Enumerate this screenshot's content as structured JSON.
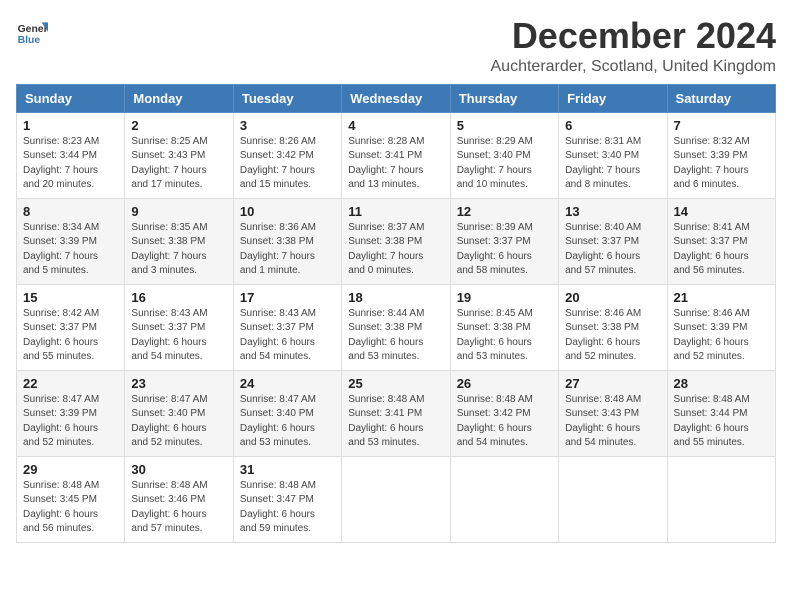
{
  "logo": {
    "line1": "General",
    "line2": "Blue"
  },
  "title": "December 2024",
  "subtitle": "Auchterarder, Scotland, United Kingdom",
  "days_of_week": [
    "Sunday",
    "Monday",
    "Tuesday",
    "Wednesday",
    "Thursday",
    "Friday",
    "Saturday"
  ],
  "weeks": [
    [
      {
        "day": "1",
        "info": "Sunrise: 8:23 AM\nSunset: 3:44 PM\nDaylight: 7 hours\nand 20 minutes."
      },
      {
        "day": "2",
        "info": "Sunrise: 8:25 AM\nSunset: 3:43 PM\nDaylight: 7 hours\nand 17 minutes."
      },
      {
        "day": "3",
        "info": "Sunrise: 8:26 AM\nSunset: 3:42 PM\nDaylight: 7 hours\nand 15 minutes."
      },
      {
        "day": "4",
        "info": "Sunrise: 8:28 AM\nSunset: 3:41 PM\nDaylight: 7 hours\nand 13 minutes."
      },
      {
        "day": "5",
        "info": "Sunrise: 8:29 AM\nSunset: 3:40 PM\nDaylight: 7 hours\nand 10 minutes."
      },
      {
        "day": "6",
        "info": "Sunrise: 8:31 AM\nSunset: 3:40 PM\nDaylight: 7 hours\nand 8 minutes."
      },
      {
        "day": "7",
        "info": "Sunrise: 8:32 AM\nSunset: 3:39 PM\nDaylight: 7 hours\nand 6 minutes."
      }
    ],
    [
      {
        "day": "8",
        "info": "Sunrise: 8:34 AM\nSunset: 3:39 PM\nDaylight: 7 hours\nand 5 minutes."
      },
      {
        "day": "9",
        "info": "Sunrise: 8:35 AM\nSunset: 3:38 PM\nDaylight: 7 hours\nand 3 minutes."
      },
      {
        "day": "10",
        "info": "Sunrise: 8:36 AM\nSunset: 3:38 PM\nDaylight: 7 hours\nand 1 minute."
      },
      {
        "day": "11",
        "info": "Sunrise: 8:37 AM\nSunset: 3:38 PM\nDaylight: 7 hours\nand 0 minutes."
      },
      {
        "day": "12",
        "info": "Sunrise: 8:39 AM\nSunset: 3:37 PM\nDaylight: 6 hours\nand 58 minutes."
      },
      {
        "day": "13",
        "info": "Sunrise: 8:40 AM\nSunset: 3:37 PM\nDaylight: 6 hours\nand 57 minutes."
      },
      {
        "day": "14",
        "info": "Sunrise: 8:41 AM\nSunset: 3:37 PM\nDaylight: 6 hours\nand 56 minutes."
      }
    ],
    [
      {
        "day": "15",
        "info": "Sunrise: 8:42 AM\nSunset: 3:37 PM\nDaylight: 6 hours\nand 55 minutes."
      },
      {
        "day": "16",
        "info": "Sunrise: 8:43 AM\nSunset: 3:37 PM\nDaylight: 6 hours\nand 54 minutes."
      },
      {
        "day": "17",
        "info": "Sunrise: 8:43 AM\nSunset: 3:37 PM\nDaylight: 6 hours\nand 54 minutes."
      },
      {
        "day": "18",
        "info": "Sunrise: 8:44 AM\nSunset: 3:38 PM\nDaylight: 6 hours\nand 53 minutes."
      },
      {
        "day": "19",
        "info": "Sunrise: 8:45 AM\nSunset: 3:38 PM\nDaylight: 6 hours\nand 53 minutes."
      },
      {
        "day": "20",
        "info": "Sunrise: 8:46 AM\nSunset: 3:38 PM\nDaylight: 6 hours\nand 52 minutes."
      },
      {
        "day": "21",
        "info": "Sunrise: 8:46 AM\nSunset: 3:39 PM\nDaylight: 6 hours\nand 52 minutes."
      }
    ],
    [
      {
        "day": "22",
        "info": "Sunrise: 8:47 AM\nSunset: 3:39 PM\nDaylight: 6 hours\nand 52 minutes."
      },
      {
        "day": "23",
        "info": "Sunrise: 8:47 AM\nSunset: 3:40 PM\nDaylight: 6 hours\nand 52 minutes."
      },
      {
        "day": "24",
        "info": "Sunrise: 8:47 AM\nSunset: 3:40 PM\nDaylight: 6 hours\nand 53 minutes."
      },
      {
        "day": "25",
        "info": "Sunrise: 8:48 AM\nSunset: 3:41 PM\nDaylight: 6 hours\nand 53 minutes."
      },
      {
        "day": "26",
        "info": "Sunrise: 8:48 AM\nSunset: 3:42 PM\nDaylight: 6 hours\nand 54 minutes."
      },
      {
        "day": "27",
        "info": "Sunrise: 8:48 AM\nSunset: 3:43 PM\nDaylight: 6 hours\nand 54 minutes."
      },
      {
        "day": "28",
        "info": "Sunrise: 8:48 AM\nSunset: 3:44 PM\nDaylight: 6 hours\nand 55 minutes."
      }
    ],
    [
      {
        "day": "29",
        "info": "Sunrise: 8:48 AM\nSunset: 3:45 PM\nDaylight: 6 hours\nand 56 minutes."
      },
      {
        "day": "30",
        "info": "Sunrise: 8:48 AM\nSunset: 3:46 PM\nDaylight: 6 hours\nand 57 minutes."
      },
      {
        "day": "31",
        "info": "Sunrise: 8:48 AM\nSunset: 3:47 PM\nDaylight: 6 hours\nand 59 minutes."
      },
      {
        "day": "",
        "info": ""
      },
      {
        "day": "",
        "info": ""
      },
      {
        "day": "",
        "info": ""
      },
      {
        "day": "",
        "info": ""
      }
    ]
  ]
}
